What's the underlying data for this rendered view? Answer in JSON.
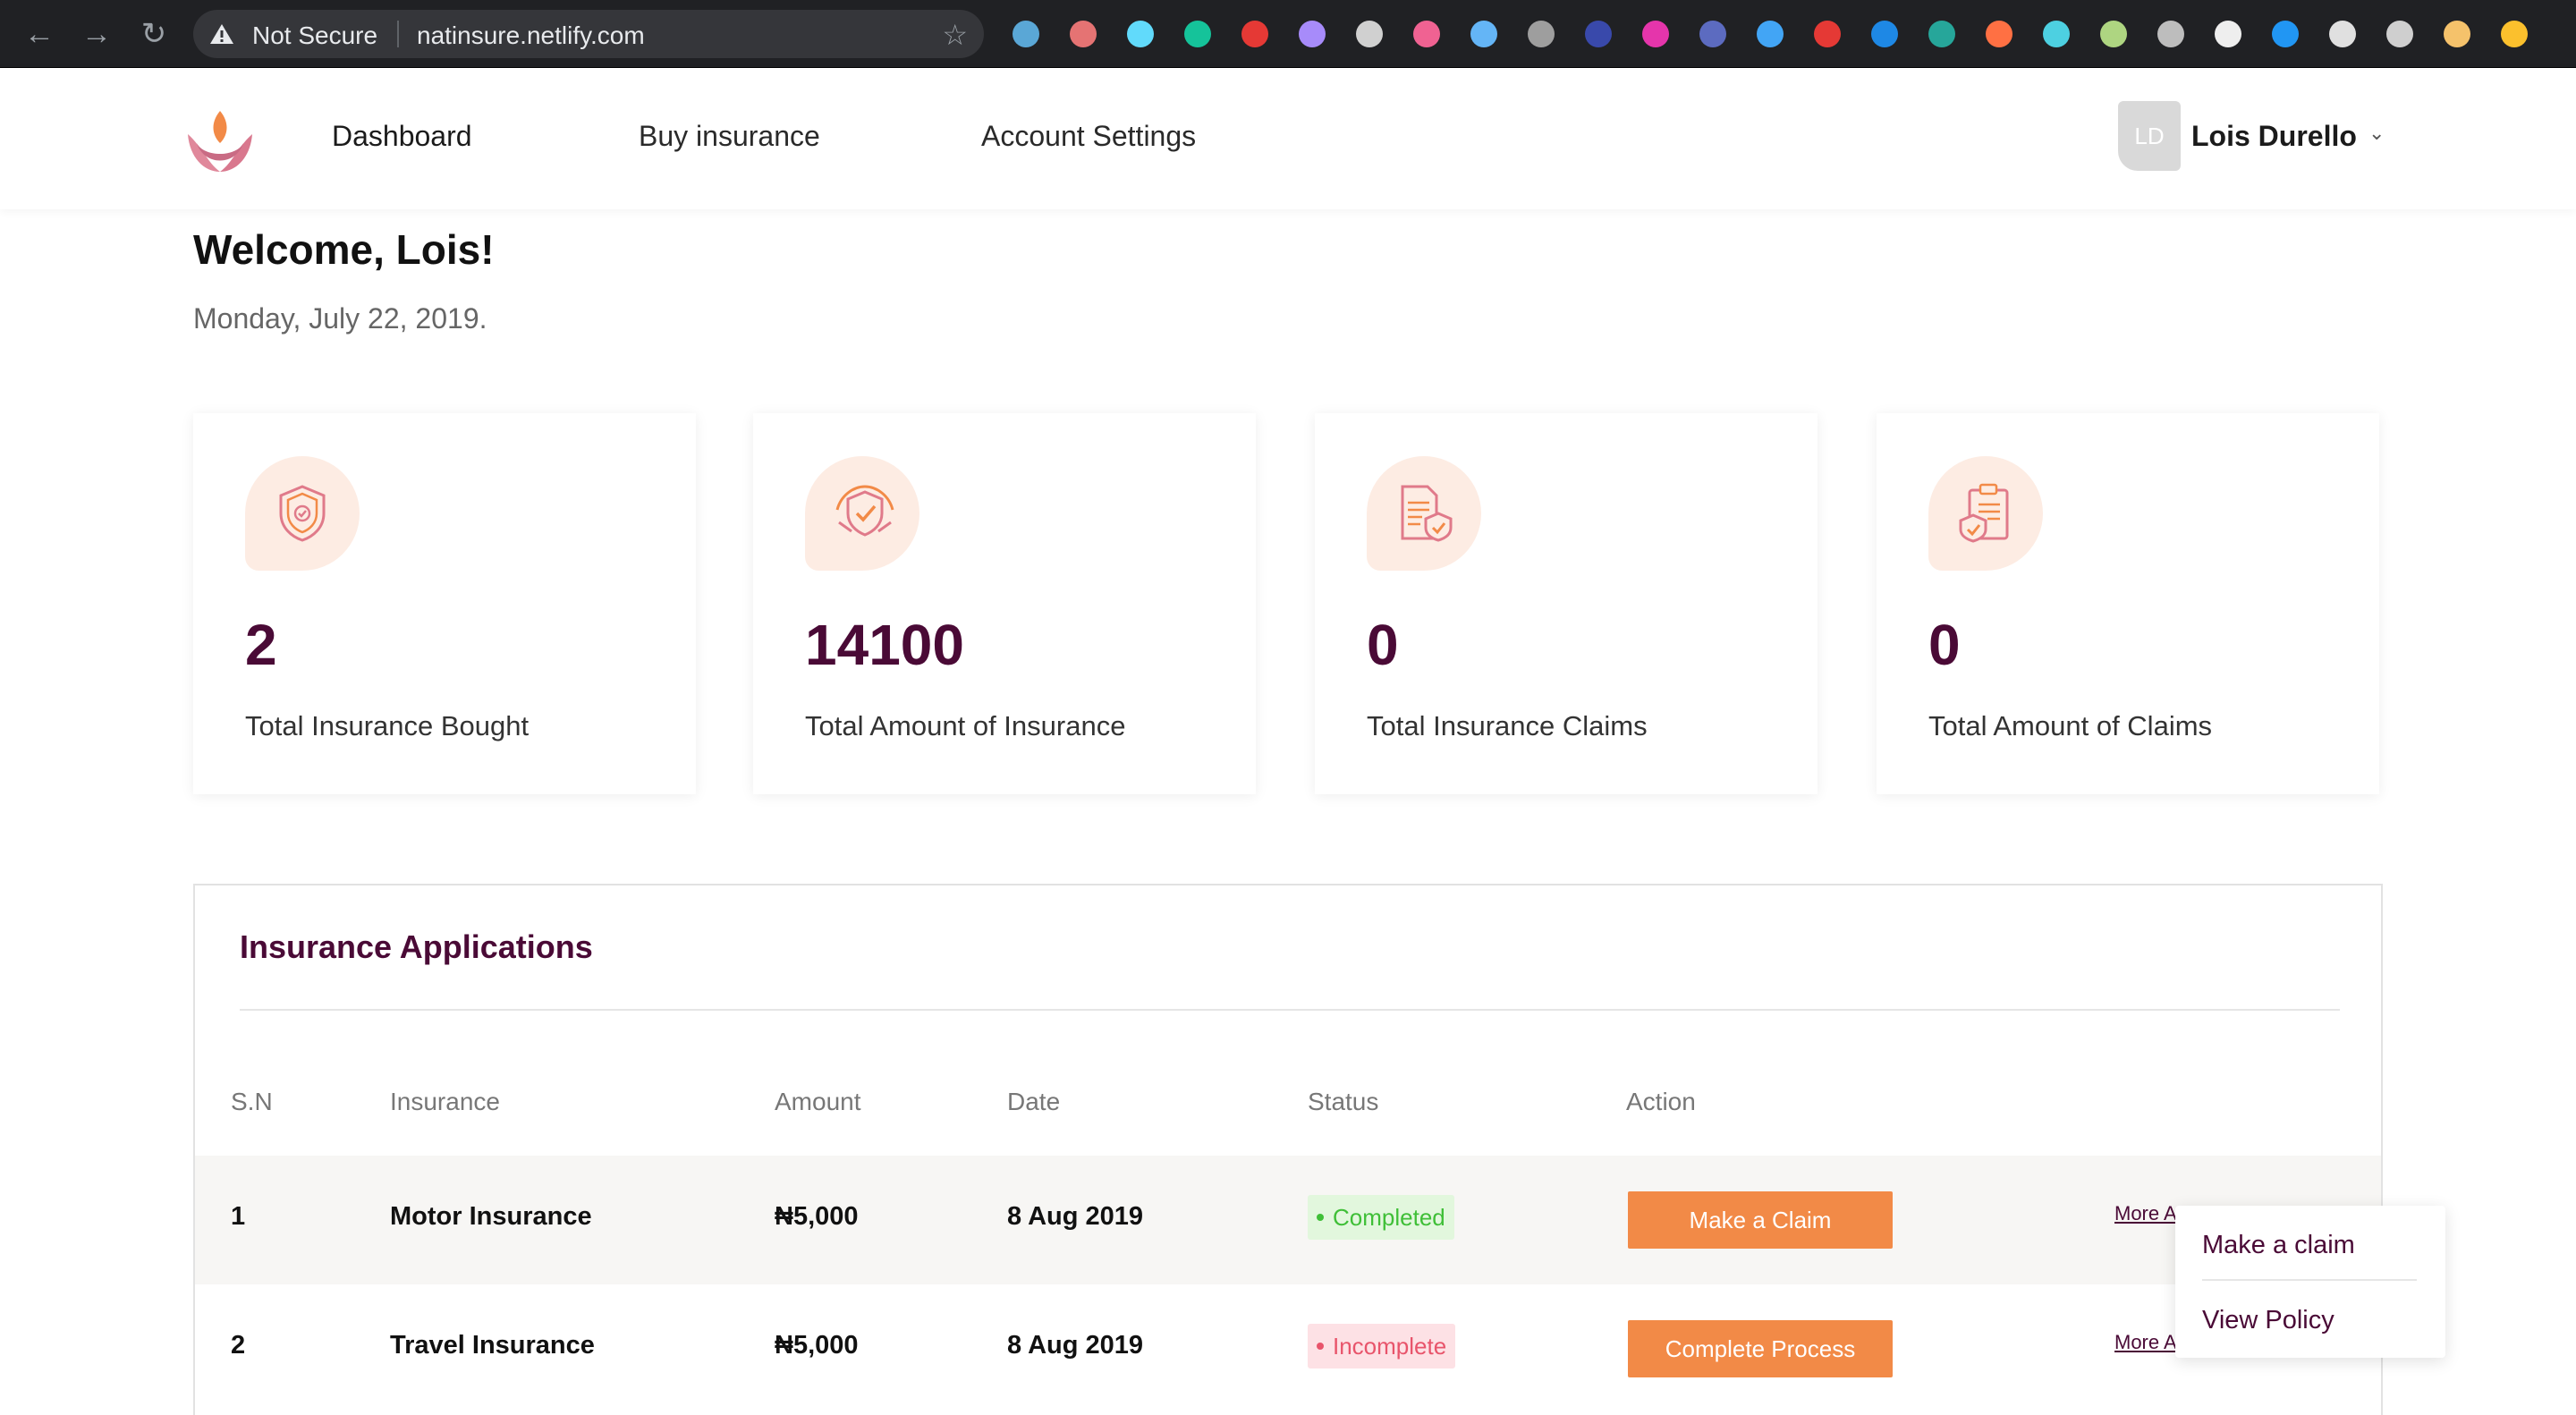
{
  "browser": {
    "security_label": "Not Secure",
    "url": "natinsure.netlify.com",
    "extensions": [
      {
        "icon": "diamond-ext-icon",
        "color": "#5aa7d6"
      },
      {
        "icon": "pen-ext-icon",
        "color": "#e57373"
      },
      {
        "icon": "react-ext-icon",
        "color": "#61dafb"
      },
      {
        "icon": "grammarly-ext-icon",
        "color": "#15c39a"
      },
      {
        "icon": "adblock-ext-icon",
        "color": "#e53935"
      },
      {
        "icon": "feather-ext-icon",
        "color": "#a78bfa"
      },
      {
        "icon": "target-ext-icon",
        "color": "#d0d0d0"
      },
      {
        "icon": "t-ext-icon",
        "color": "#f06292"
      },
      {
        "icon": "grid-ext-icon",
        "color": "#64b5f6"
      },
      {
        "icon": "braces-ext-icon",
        "color": "#9e9e9e"
      },
      {
        "icon": "a-ext-icon",
        "color": "#3949ab"
      },
      {
        "icon": "graphql-ext-icon",
        "color": "#e535ab"
      },
      {
        "icon": "link-ext-icon",
        "color": "#5c6bc0"
      },
      {
        "icon": "box-ext-icon",
        "color": "#42a5f5"
      },
      {
        "icon": "trash-ext-icon",
        "color": "#e53935"
      },
      {
        "icon": "search-ext-icon",
        "color": "#1e88e5"
      },
      {
        "icon": "infinity-ext-icon",
        "color": "#26a69a"
      },
      {
        "icon": "fingerprint-ext-icon",
        "color": "#ff7043"
      },
      {
        "icon": "network-ext-icon",
        "color": "#4dd0e1"
      },
      {
        "icon": "leaf-ext-icon",
        "color": "#aed581"
      },
      {
        "icon": "code-ext-icon",
        "color": "#bdbdbd"
      },
      {
        "icon": "camera-ext-icon",
        "color": "#eeeeee"
      },
      {
        "icon": "triangle-ext-icon",
        "color": "#2196f3"
      },
      {
        "icon": "circle-ext-icon",
        "color": "#e0e0e0"
      },
      {
        "icon": "paint-ext-icon",
        "color": "#cfcfcf"
      },
      {
        "icon": "profile-ext-icon",
        "color": "#f5c26b"
      },
      {
        "icon": "smile-ext-icon",
        "color": "#fbc02d"
      }
    ]
  },
  "header": {
    "nav": [
      {
        "label": "Dashboard"
      },
      {
        "label": "Buy insurance"
      },
      {
        "label": "Account Settings"
      }
    ],
    "user": {
      "initials": "LD",
      "name": "Lois Durello"
    }
  },
  "welcome": {
    "title": "Welcome, Lois!",
    "date": "Monday, July 22, 2019."
  },
  "stats": [
    {
      "icon": "shield-icon",
      "value": "2",
      "label": "Total Insurance Bought"
    },
    {
      "icon": "handshake-shield-icon",
      "value": "14100",
      "label": "Total Amount of Insurance"
    },
    {
      "icon": "document-shield-icon",
      "value": "0",
      "label": "Total Insurance Claims"
    },
    {
      "icon": "clipboard-shield-icon",
      "value": "0",
      "label": "Total Amount of Claims"
    }
  ],
  "applications": {
    "title": "Insurance Applications",
    "columns": [
      "S.N",
      "Insurance",
      "Amount",
      "Date",
      "Status",
      "Action"
    ],
    "rows": [
      {
        "sn": "1",
        "insurance": "Motor Insurance",
        "amount": "₦5,000",
        "date": "8 Aug 2019",
        "status": "Completed",
        "action": "Make a Claim",
        "more": "More A"
      },
      {
        "sn": "2",
        "insurance": "Travel Insurance",
        "amount": "₦5,000",
        "date": "8 Aug 2019",
        "status": "Incomplete",
        "action": "Complete Process",
        "more": "More A"
      }
    ]
  },
  "dropdown": {
    "items": [
      "Make a claim",
      "View Policy"
    ]
  },
  "colors": {
    "brand": "#4a0a36",
    "accent": "#f28a47",
    "success": "#3fbf37",
    "danger": "#e8546b"
  }
}
